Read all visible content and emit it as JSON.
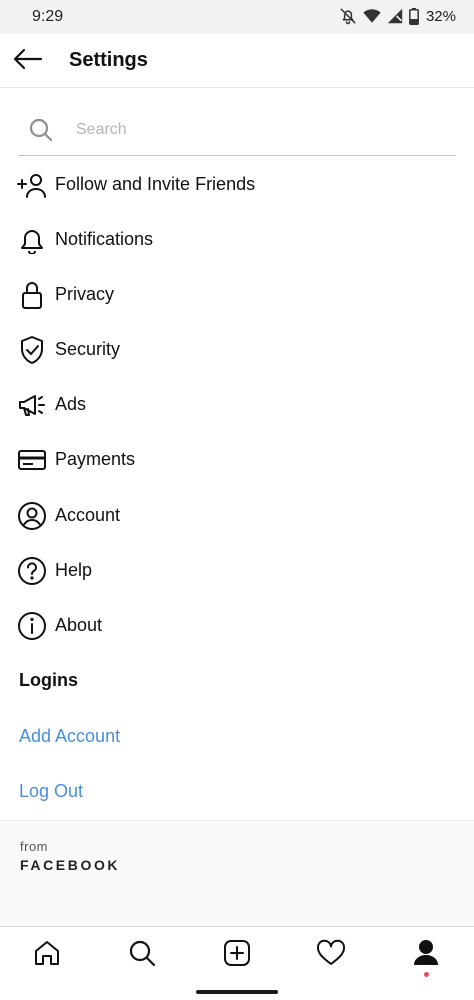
{
  "status_bar": {
    "time": "9:29",
    "battery": "32%",
    "icons": [
      "notifications-off-icon",
      "wifi-icon",
      "cellular-signal-icon",
      "battery-icon"
    ]
  },
  "header": {
    "title": "Settings",
    "back_icon": "arrow-left-icon"
  },
  "search": {
    "placeholder": "Search",
    "value": ""
  },
  "menu": {
    "items": [
      {
        "label": "Follow and Invite Friends",
        "icon": "add-person-icon"
      },
      {
        "label": "Notifications",
        "icon": "bell-icon"
      },
      {
        "label": "Privacy",
        "icon": "lock-icon"
      },
      {
        "label": "Security",
        "icon": "shield-icon"
      },
      {
        "label": "Ads",
        "icon": "megaphone-icon"
      },
      {
        "label": "Payments",
        "icon": "credit-card-icon"
      },
      {
        "label": "Account",
        "icon": "user-circle-icon"
      },
      {
        "label": "Help",
        "icon": "help-circle-icon"
      },
      {
        "label": "About",
        "icon": "info-circle-icon"
      }
    ]
  },
  "logins": {
    "title": "Logins",
    "add_account": "Add Account",
    "log_out": "Log Out"
  },
  "footer": {
    "from": "from",
    "brand": "FACEBOOK"
  },
  "bottom_nav": {
    "items": [
      "home-icon",
      "search-icon",
      "new-post-icon",
      "heart-icon",
      "profile-icon"
    ],
    "active": "profile-icon"
  },
  "colors": {
    "link": "#4a8ed8",
    "notification_dot": "#ed4956",
    "status_bar_bg": "#f2f2f2"
  }
}
